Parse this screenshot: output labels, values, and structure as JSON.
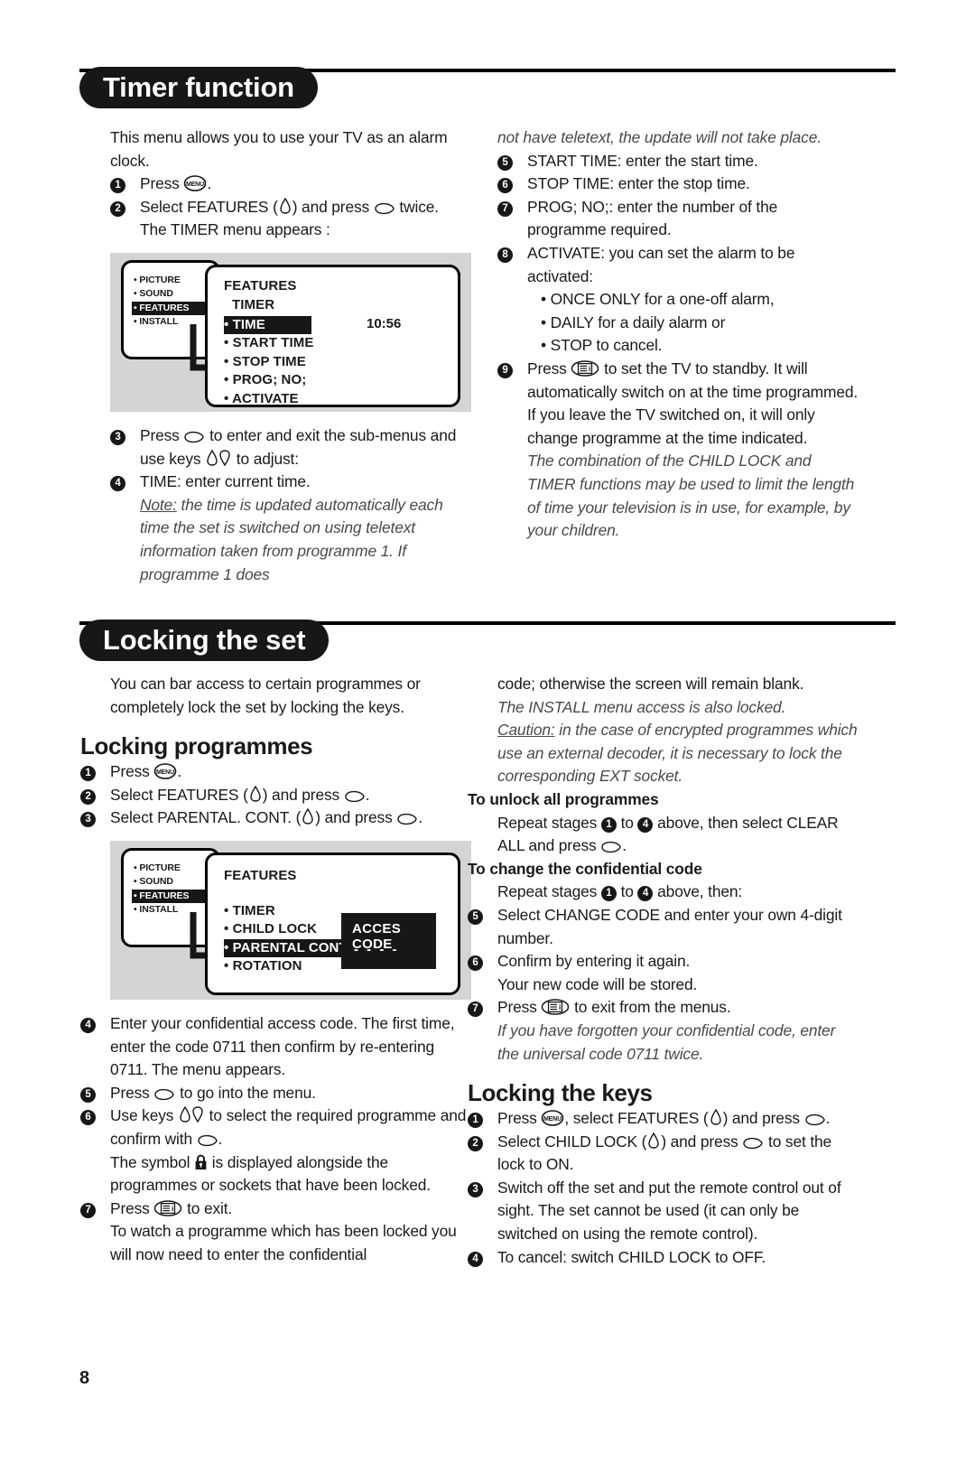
{
  "page": {
    "number": "8"
  },
  "sections": [
    {
      "id": "timer",
      "title": "Timer function",
      "left": {
        "intro": "This menu allows you to use your TV as an alarm clock.",
        "steps_before_figure": [
          {
            "num": "1",
            "text_before": "Press ",
            "icon": "menu-key-icon",
            "text_after": "."
          },
          {
            "num": "2",
            "text_before": "Select FEATURES (",
            "icon": "cursor-up-down-icon",
            "text_after": ") and press ",
            "icon2": "cursor-right-icon",
            "text_end": " twice."
          },
          {
            "num": "",
            "text": "The TIMER menu appears :"
          }
        ],
        "steps_after_figure": [
          {
            "num": "3",
            "a": "Press ",
            "b": " to enter and exit the sub-menus and use keys ",
            "c": " to adjust:"
          },
          {
            "num": "4",
            "a": "TIME: enter current time."
          }
        ],
        "note_label": "Note:",
        "note_text": " the time is updated automatically each time the set is switched on using teletext information taken from programme 1. If programme 1 does"
      },
      "right": {
        "continued_italic": "not have teletext, the update will not take place.",
        "steps": [
          {
            "num": "5",
            "text": "START TIME: enter the start time."
          },
          {
            "num": "6",
            "text": "STOP TIME: enter the stop time."
          },
          {
            "num": "7",
            "text": "PROG; NO;: enter the number of the programme required."
          },
          {
            "num": "8",
            "text": "ACTIVATE: you can set the alarm to be activated:"
          }
        ],
        "activate_options": [
          "• ONCE ONLY for a one-off alarm,",
          "• DAILY for a daily alarm or",
          "• STOP to cancel."
        ],
        "step9_a": "Press ",
        "step9_b": " to set the TV to standby. It will automatically switch on at the time programmed. If you leave the TV switched on, it will only change programme at the time indicated.",
        "step9_num": "9",
        "closing_italic": "The combination of the CHILD LOCK and TIMER functions may be used to limit the length of time your television is in use, for example, by your children."
      },
      "figure": {
        "left_menu": [
          "PICTURE",
          "SOUND",
          "FEATURES",
          "INSTALL"
        ],
        "left_selected": "FEATURES",
        "title": "FEATURES",
        "subtitle": "TIMER",
        "items": [
          "TIME",
          "START TIME",
          "STOP TIME",
          "PROG; NO;",
          "ACTIVATE"
        ],
        "selected": "TIME",
        "value": "10:56"
      }
    },
    {
      "id": "locking",
      "title": "Locking the set",
      "left": {
        "intro": "You can bar access to certain programmes or completely lock the set by locking the keys.",
        "subhead": "Locking programmes",
        "steps_before_figure": [
          {
            "num": "1",
            "a": "Press ",
            "b": "."
          },
          {
            "num": "2",
            "a": "Select FEATURES (",
            "b": ") and press ",
            "c": "."
          },
          {
            "num": "3",
            "a": "Select PARENTAL. CONT. (",
            "b": ") and press ",
            "c": "."
          }
        ],
        "steps_after_figure": [
          {
            "num": "4",
            "text": "Enter your confidential access code. The first time, enter the code 0711 then confirm by re-entering 0711. The menu appears."
          },
          {
            "num": "5",
            "a": "Press ",
            "b": " to go into the menu."
          },
          {
            "num": "6",
            "a": "Use keys ",
            "b": " to select the required programme and confirm with ",
            "c": "."
          }
        ],
        "symbol_line_a": "The symbol ",
        "symbol_line_b": " is displayed alongside the programmes or sockets that have been locked.",
        "step7_num": "7",
        "step7_a": "Press ",
        "step7_b": " to exit.",
        "tail": "To watch a programme which has been locked you will now need to enter the confidential"
      },
      "right": {
        "continued": "code; otherwise the screen will remain blank.",
        "italic1": "The INSTALL menu access is also locked.",
        "caution_label": "Caution:",
        "caution_text": " in the case of encrypted programmes which use an external decoder, it is necessary to lock the corresponding EXT socket.",
        "unlock_head": "To unlock all programmes",
        "unlock_a": "Repeat stages ",
        "unlock_b": " to ",
        "unlock_c": " above, then select CLEAR ALL and press ",
        "unlock_d": ".",
        "unlock_n1": "1",
        "unlock_n2": "4",
        "change_head": "To change the confidential code",
        "change_a": "Repeat stages ",
        "change_b": " to ",
        "change_c": " above, then:",
        "change_n1": "1",
        "change_n2": "4",
        "change_steps": [
          {
            "num": "5",
            "text": "Select CHANGE CODE and enter your own 4-digit number."
          },
          {
            "num": "6",
            "text": "Confirm by entering it again."
          },
          {
            "num": "",
            "text": "Your new code will be stored."
          }
        ],
        "step7_num": "7",
        "step7_a": "Press ",
        "step7_b": " to exit from the menus.",
        "forgot_italic": "If you have forgotten your confidential code, enter the universal code 0711 twice.",
        "keys_head": "Locking the keys",
        "keys_steps": [
          {
            "num": "1",
            "a": "Press ",
            "b": ", select FEATURES (",
            "c": ") and press ",
            "d": "."
          },
          {
            "num": "2",
            "a": "Select CHILD LOCK (",
            "b": ") and press ",
            "c": " to set the lock to ON."
          },
          {
            "num": "3",
            "text": "Switch off the set and put the remote control out of sight. The set cannot be used (it can only be switched on using the remote control)."
          },
          {
            "num": "4",
            "text": "To cancel: switch CHILD LOCK to OFF."
          }
        ]
      },
      "figure": {
        "left_menu": [
          "PICTURE",
          "SOUND",
          "FEATURES",
          "INSTALL"
        ],
        "left_selected": "FEATURES",
        "title": "FEATURES",
        "items": [
          "TIMER",
          "CHILD LOCK",
          "PARENTAL CONT",
          "ROTATION"
        ],
        "selected": "PARENTAL CONT",
        "code_box_title": "ACCES CODE",
        "code_box_dashes": "- - - -"
      }
    }
  ],
  "icons": {
    "menu_key": "menu-key-icon",
    "cursor_right": "cursor-right-icon",
    "cursor_up_down": "cursor-up-down-icon",
    "cursor_down": "cursor-down-icon",
    "teletext_exit": "teletext-exit-icon",
    "padlock": "padlock-icon"
  },
  "colors": {
    "ink": "#1a1a1a",
    "banner_bg": "#17171a",
    "figure_bg": "#d4d4d4",
    "italic_ink": "#4a4a4a"
  }
}
